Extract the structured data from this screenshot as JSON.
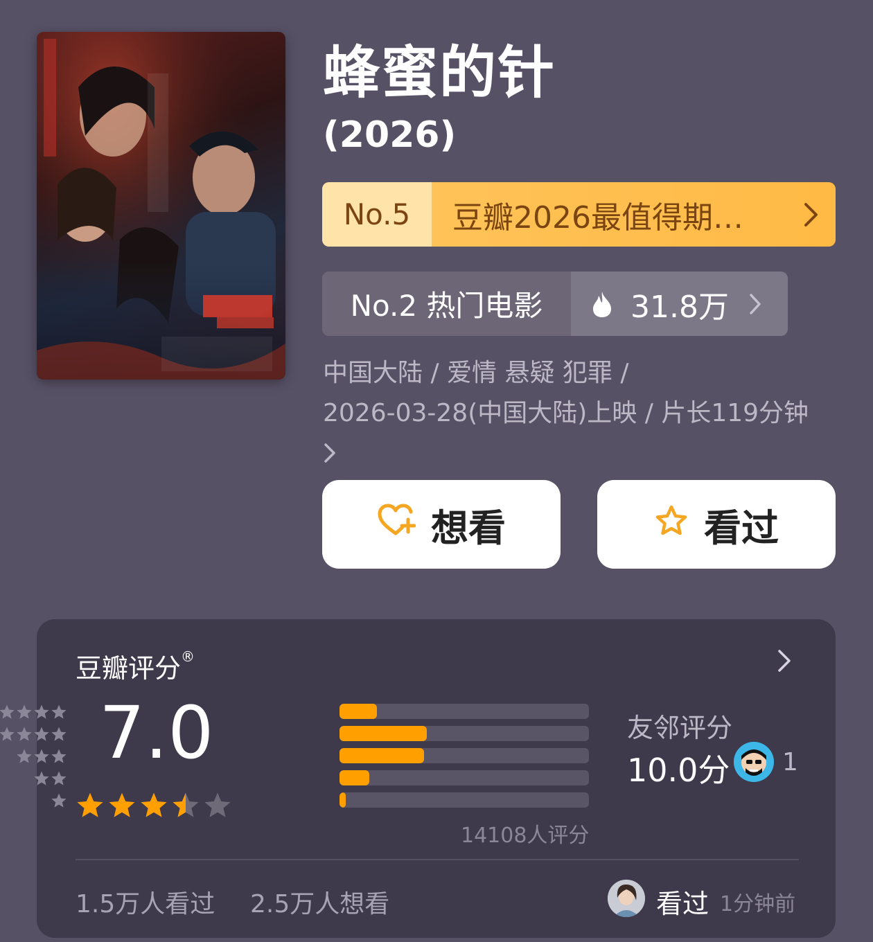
{
  "movie": {
    "title": "蜂蜜的针",
    "year": "(2026)"
  },
  "ranking_1": {
    "rank": "No.5",
    "list_name": "豆瓣2026最值得期…",
    "color_bg": "#ffba45",
    "color_text": "#7a4510"
  },
  "ranking_2": {
    "rank_label": "No.2 热门电影",
    "heat_value": "31.8万"
  },
  "meta": {
    "line1": "中国大陆 / 爱情 悬疑 犯罪 /",
    "line2": "2026-03-28(中国大陆)上映 / 片长119分钟"
  },
  "actions": {
    "want_label": "想看",
    "seen_label": "看过",
    "accent": "#f5a623"
  },
  "rating": {
    "title": "豆瓣评分",
    "registered_mark": "®",
    "score": "7.0",
    "stars_value": 3.5,
    "distribution": [
      {
        "stars": 5,
        "fraction": 0.15
      },
      {
        "stars": 4,
        "fraction": 0.35
      },
      {
        "stars": 3,
        "fraction": 0.34
      },
      {
        "stars": 2,
        "fraction": 0.12
      },
      {
        "stars": 1,
        "fraction": 0.025
      }
    ],
    "count_text": "14108人评分",
    "bar_color": "#ff9f00"
  },
  "friends": {
    "label": "友邻评分",
    "score": "10.0分",
    "count": "1"
  },
  "footer": {
    "seen_count": "1.5万人看过",
    "want_count": "2.5万人想看",
    "activity_action": "看过",
    "activity_time": "1分钟前"
  }
}
